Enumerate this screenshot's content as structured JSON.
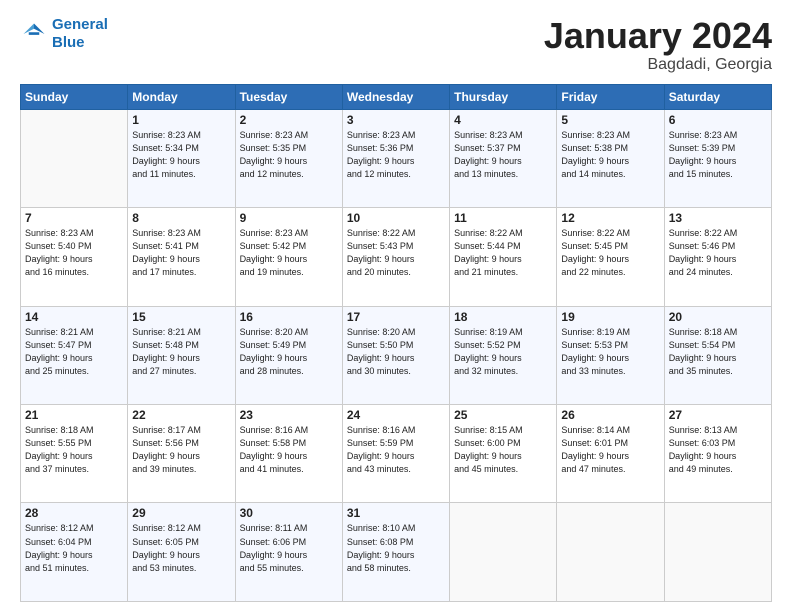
{
  "header": {
    "logo_line1": "General",
    "logo_line2": "Blue",
    "month": "January 2024",
    "location": "Bagdadi, Georgia"
  },
  "weekdays": [
    "Sunday",
    "Monday",
    "Tuesday",
    "Wednesday",
    "Thursday",
    "Friday",
    "Saturday"
  ],
  "weeks": [
    [
      {
        "day": "",
        "info": ""
      },
      {
        "day": "1",
        "info": "Sunrise: 8:23 AM\nSunset: 5:34 PM\nDaylight: 9 hours\nand 11 minutes."
      },
      {
        "day": "2",
        "info": "Sunrise: 8:23 AM\nSunset: 5:35 PM\nDaylight: 9 hours\nand 12 minutes."
      },
      {
        "day": "3",
        "info": "Sunrise: 8:23 AM\nSunset: 5:36 PM\nDaylight: 9 hours\nand 12 minutes."
      },
      {
        "day": "4",
        "info": "Sunrise: 8:23 AM\nSunset: 5:37 PM\nDaylight: 9 hours\nand 13 minutes."
      },
      {
        "day": "5",
        "info": "Sunrise: 8:23 AM\nSunset: 5:38 PM\nDaylight: 9 hours\nand 14 minutes."
      },
      {
        "day": "6",
        "info": "Sunrise: 8:23 AM\nSunset: 5:39 PM\nDaylight: 9 hours\nand 15 minutes."
      }
    ],
    [
      {
        "day": "7",
        "info": "Sunrise: 8:23 AM\nSunset: 5:40 PM\nDaylight: 9 hours\nand 16 minutes."
      },
      {
        "day": "8",
        "info": "Sunrise: 8:23 AM\nSunset: 5:41 PM\nDaylight: 9 hours\nand 17 minutes."
      },
      {
        "day": "9",
        "info": "Sunrise: 8:23 AM\nSunset: 5:42 PM\nDaylight: 9 hours\nand 19 minutes."
      },
      {
        "day": "10",
        "info": "Sunrise: 8:22 AM\nSunset: 5:43 PM\nDaylight: 9 hours\nand 20 minutes."
      },
      {
        "day": "11",
        "info": "Sunrise: 8:22 AM\nSunset: 5:44 PM\nDaylight: 9 hours\nand 21 minutes."
      },
      {
        "day": "12",
        "info": "Sunrise: 8:22 AM\nSunset: 5:45 PM\nDaylight: 9 hours\nand 22 minutes."
      },
      {
        "day": "13",
        "info": "Sunrise: 8:22 AM\nSunset: 5:46 PM\nDaylight: 9 hours\nand 24 minutes."
      }
    ],
    [
      {
        "day": "14",
        "info": "Sunrise: 8:21 AM\nSunset: 5:47 PM\nDaylight: 9 hours\nand 25 minutes."
      },
      {
        "day": "15",
        "info": "Sunrise: 8:21 AM\nSunset: 5:48 PM\nDaylight: 9 hours\nand 27 minutes."
      },
      {
        "day": "16",
        "info": "Sunrise: 8:20 AM\nSunset: 5:49 PM\nDaylight: 9 hours\nand 28 minutes."
      },
      {
        "day": "17",
        "info": "Sunrise: 8:20 AM\nSunset: 5:50 PM\nDaylight: 9 hours\nand 30 minutes."
      },
      {
        "day": "18",
        "info": "Sunrise: 8:19 AM\nSunset: 5:52 PM\nDaylight: 9 hours\nand 32 minutes."
      },
      {
        "day": "19",
        "info": "Sunrise: 8:19 AM\nSunset: 5:53 PM\nDaylight: 9 hours\nand 33 minutes."
      },
      {
        "day": "20",
        "info": "Sunrise: 8:18 AM\nSunset: 5:54 PM\nDaylight: 9 hours\nand 35 minutes."
      }
    ],
    [
      {
        "day": "21",
        "info": "Sunrise: 8:18 AM\nSunset: 5:55 PM\nDaylight: 9 hours\nand 37 minutes."
      },
      {
        "day": "22",
        "info": "Sunrise: 8:17 AM\nSunset: 5:56 PM\nDaylight: 9 hours\nand 39 minutes."
      },
      {
        "day": "23",
        "info": "Sunrise: 8:16 AM\nSunset: 5:58 PM\nDaylight: 9 hours\nand 41 minutes."
      },
      {
        "day": "24",
        "info": "Sunrise: 8:16 AM\nSunset: 5:59 PM\nDaylight: 9 hours\nand 43 minutes."
      },
      {
        "day": "25",
        "info": "Sunrise: 8:15 AM\nSunset: 6:00 PM\nDaylight: 9 hours\nand 45 minutes."
      },
      {
        "day": "26",
        "info": "Sunrise: 8:14 AM\nSunset: 6:01 PM\nDaylight: 9 hours\nand 47 minutes."
      },
      {
        "day": "27",
        "info": "Sunrise: 8:13 AM\nSunset: 6:03 PM\nDaylight: 9 hours\nand 49 minutes."
      }
    ],
    [
      {
        "day": "28",
        "info": "Sunrise: 8:12 AM\nSunset: 6:04 PM\nDaylight: 9 hours\nand 51 minutes."
      },
      {
        "day": "29",
        "info": "Sunrise: 8:12 AM\nSunset: 6:05 PM\nDaylight: 9 hours\nand 53 minutes."
      },
      {
        "day": "30",
        "info": "Sunrise: 8:11 AM\nSunset: 6:06 PM\nDaylight: 9 hours\nand 55 minutes."
      },
      {
        "day": "31",
        "info": "Sunrise: 8:10 AM\nSunset: 6:08 PM\nDaylight: 9 hours\nand 58 minutes."
      },
      {
        "day": "",
        "info": ""
      },
      {
        "day": "",
        "info": ""
      },
      {
        "day": "",
        "info": ""
      }
    ]
  ]
}
